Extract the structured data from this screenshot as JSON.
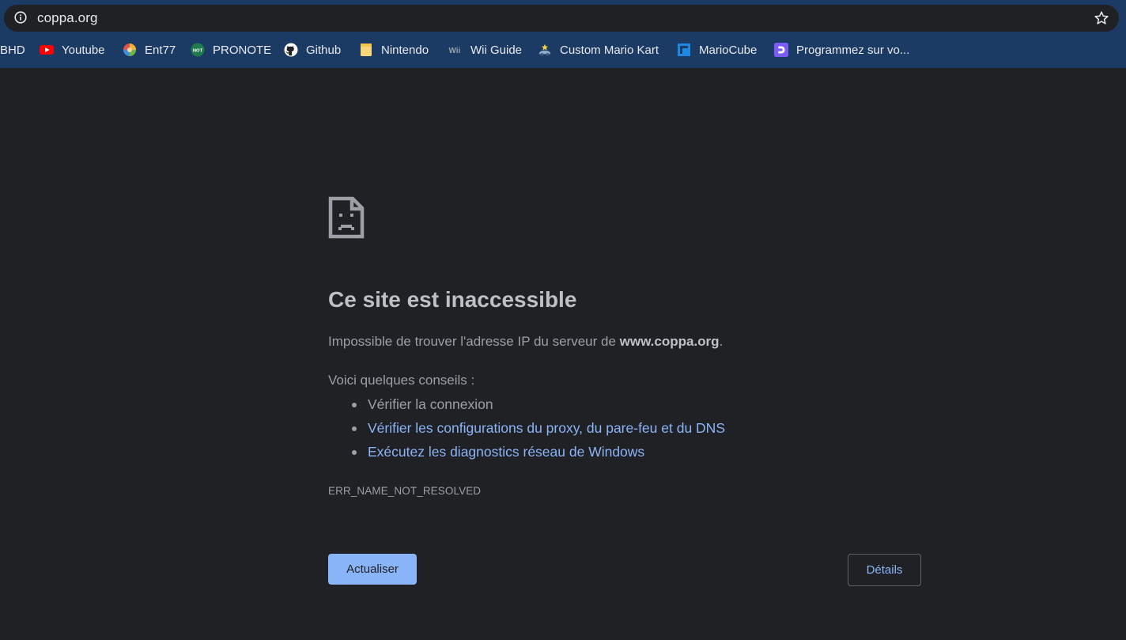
{
  "browser": {
    "url": "coppa.org",
    "bookmarks": [
      {
        "label": "BHD",
        "icon": "none"
      },
      {
        "label": "Youtube",
        "icon": "youtube-icon"
      },
      {
        "label": "Ent77",
        "icon": "ent77-icon"
      },
      {
        "label": "PRONOTE",
        "icon": "pronote-icon",
        "icon_text": "NOT"
      },
      {
        "label": "Github",
        "icon": "github-icon"
      },
      {
        "label": "Nintendo",
        "icon": "folder-icon"
      },
      {
        "label": "Wii Guide",
        "icon": "wii-icon",
        "icon_text": "Wii"
      },
      {
        "label": "Custom Mario Kart",
        "icon": "mario-kart-icon"
      },
      {
        "label": "MarioCube",
        "icon": "mariocube-icon"
      },
      {
        "label": "Programmez sur vo...",
        "icon": "programmez-icon"
      }
    ]
  },
  "error_page": {
    "title": "Ce site est inaccessible",
    "desc_prefix": "Impossible de trouver l'adresse IP du serveur de ",
    "desc_host": "www.coppa.org",
    "desc_suffix": ".",
    "tips_heading": "Voici quelques conseils :",
    "tips": [
      {
        "text": "Vérifier la connexion",
        "link": false
      },
      {
        "text": "Vérifier les configurations du proxy, du pare-feu et du DNS",
        "link": true
      },
      {
        "text": "Exécutez les diagnostics réseau de Windows",
        "link": true
      }
    ],
    "error_code": "ERR_NAME_NOT_RESOLVED",
    "reload_label": "Actualiser",
    "details_label": "Détails"
  },
  "colors": {
    "page_bg": "#202124",
    "toolbar_bg": "#1b3a64",
    "link": "#8ab4f8",
    "text": "#9aa0a6",
    "heading": "#bdc1c6"
  }
}
